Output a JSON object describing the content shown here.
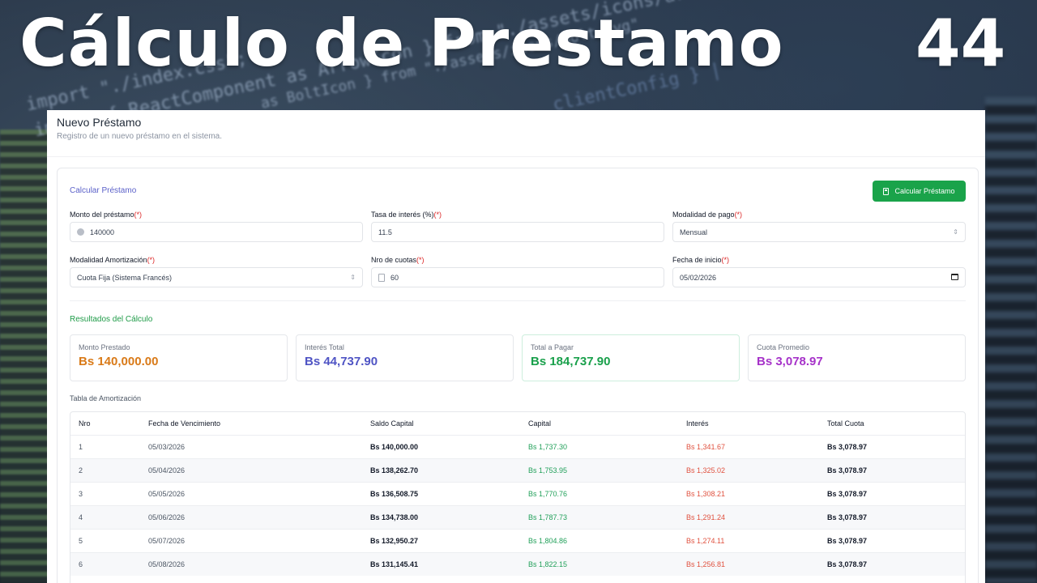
{
  "overlay": {
    "title": "Cálculo de Prestamo",
    "episode": "44"
  },
  "background_code": [
    "import \"./index.css\";",
    "import { ReactComponent as ArrowIcon } from \"./assets/icons/arrow",
    "as BoltIcon } from \"./assets/icons/bolt.svg\"",
    "import { ReactComponent as ArrowIcon } from \"./assets/icons/right-arrow.svg\"",
    "clientConfig } |"
  ],
  "header": {
    "title": "Nuevo Préstamo",
    "subtitle": "Registro de un nuevo préstamo en el sistema."
  },
  "form": {
    "section_title": "Calcular Préstamo",
    "calc_button": "Calcular Préstamo",
    "required_mark": "(*)",
    "amount": {
      "label": "Monto del préstamo",
      "value": "140000"
    },
    "rate": {
      "label": "Tasa de interés (%)",
      "value": "11.5"
    },
    "payment_mode": {
      "label": "Modalidad de pago",
      "value": "Mensual"
    },
    "amortization": {
      "label": "Modalidad Amortización",
      "value": "Cuota Fija (Sistema Francés)"
    },
    "installments": {
      "label": "Nro de cuotas",
      "value": "60"
    },
    "start_date": {
      "label": "Fecha de inicio",
      "value": "05/02/2026"
    }
  },
  "results": {
    "section_title": "Resultados del Cálculo",
    "cards": [
      {
        "label": "Monto Prestado",
        "value": "Bs 140,000.00",
        "color": "#d97a18"
      },
      {
        "label": "Interés Total",
        "value": "Bs 44,737.90",
        "color": "#4f54c4"
      },
      {
        "label": "Total a Pagar",
        "value": "Bs 184,737.90",
        "color": "#19a04b"
      },
      {
        "label": "Cuota Promedio",
        "value": "Bs 3,078.97",
        "color": "#a632c9"
      }
    ]
  },
  "table": {
    "caption": "Tabla de Amortización",
    "headers": [
      "Nro",
      "Fecha de Vencimiento",
      "Saldo Capital",
      "Capital",
      "Interés",
      "Total Cuota"
    ],
    "rows": [
      [
        "1",
        "05/03/2026",
        "Bs 140,000.00",
        "Bs 1,737.30",
        "Bs 1,341.67",
        "Bs 3,078.97"
      ],
      [
        "2",
        "05/04/2026",
        "Bs 138,262.70",
        "Bs 1,753.95",
        "Bs 1,325.02",
        "Bs 3,078.97"
      ],
      [
        "3",
        "05/05/2026",
        "Bs 136,508.75",
        "Bs 1,770.76",
        "Bs 1,308.21",
        "Bs 3,078.97"
      ],
      [
        "4",
        "05/06/2026",
        "Bs 134,738.00",
        "Bs 1,787.73",
        "Bs 1,291.24",
        "Bs 3,078.97"
      ],
      [
        "5",
        "05/07/2026",
        "Bs 132,950.27",
        "Bs 1,804.86",
        "Bs 1,274.11",
        "Bs 3,078.97"
      ],
      [
        "6",
        "05/08/2026",
        "Bs 131,145.41",
        "Bs 1,822.15",
        "Bs 1,256.81",
        "Bs 3,078.97"
      ]
    ]
  }
}
